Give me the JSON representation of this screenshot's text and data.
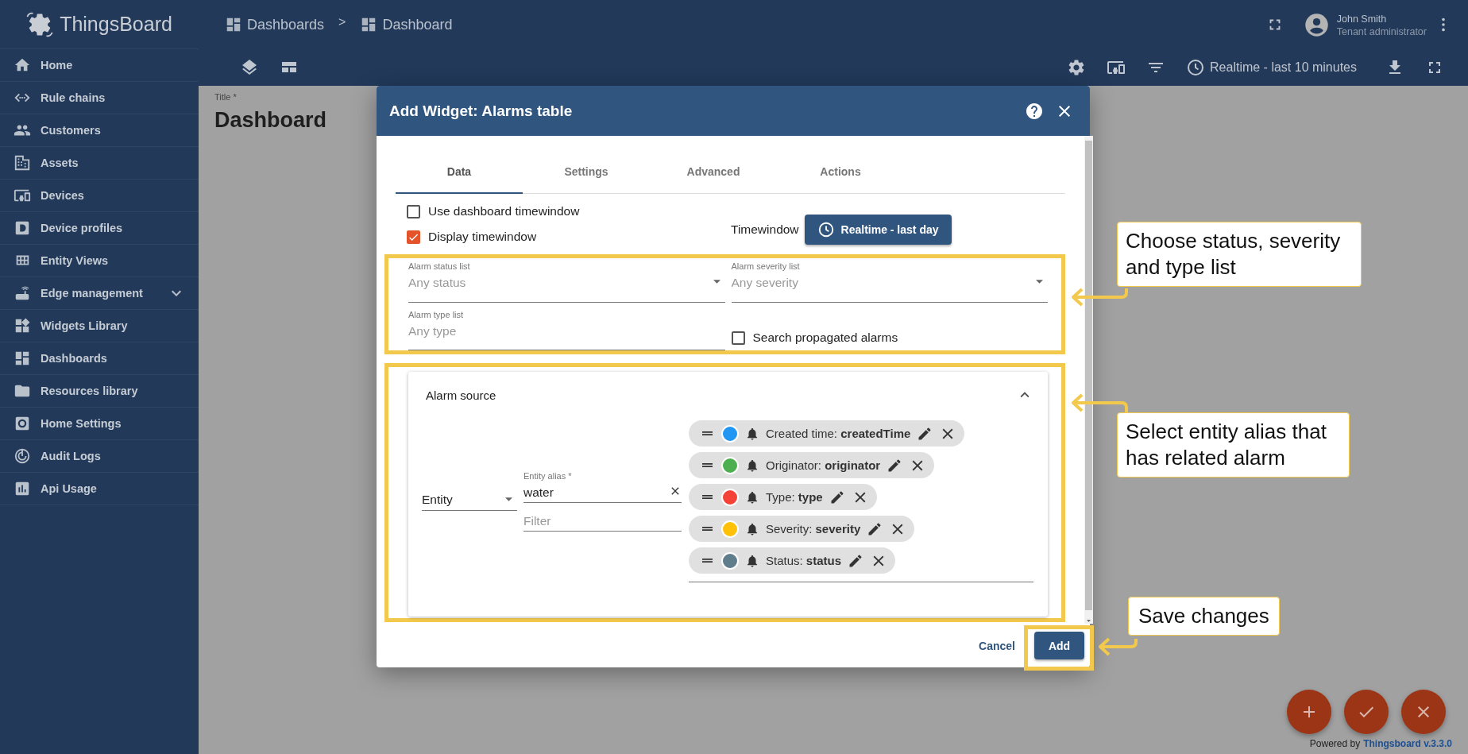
{
  "sidebar": {
    "logo": "ThingsBoard",
    "items": [
      {
        "label": "Home",
        "kind": "link"
      },
      {
        "label": "Rule chains",
        "kind": "link"
      },
      {
        "label": "Customers",
        "kind": "link"
      },
      {
        "label": "Assets",
        "kind": "link"
      },
      {
        "label": "Devices",
        "kind": "link"
      },
      {
        "label": "Device profiles",
        "kind": "link"
      },
      {
        "label": "Entity Views",
        "kind": "link"
      },
      {
        "label": "Edge management",
        "kind": "group"
      },
      {
        "label": "Widgets Library",
        "kind": "link"
      },
      {
        "label": "Dashboards",
        "kind": "link"
      },
      {
        "label": "Resources library",
        "kind": "link"
      },
      {
        "label": "Home Settings",
        "kind": "link"
      },
      {
        "label": "Audit Logs",
        "kind": "link"
      },
      {
        "label": "Api Usage",
        "kind": "link"
      }
    ]
  },
  "topbar": {
    "breadcrumbs": [
      {
        "label": "Dashboards"
      },
      {
        "label": "Dashboard"
      }
    ],
    "separator": ">",
    "user": {
      "name": "John Smith",
      "role": "Tenant administrator"
    }
  },
  "toolbar": {
    "timewindow": "Realtime - last 10 minutes"
  },
  "dashboard": {
    "title_label": "Title *",
    "title": "Dashboard"
  },
  "dialog": {
    "title": "Add Widget: Alarms table",
    "tabs": [
      {
        "label": "Data",
        "selected": true
      },
      {
        "label": "Settings",
        "selected": false
      },
      {
        "label": "Advanced",
        "selected": false
      },
      {
        "label": "Actions",
        "selected": false
      }
    ],
    "checkboxes": [
      {
        "label": "Use dashboard timewindow",
        "checked": false
      },
      {
        "label": "Display timewindow",
        "checked": true
      }
    ],
    "timewindow_label": "Timewindow",
    "timewindow_button": "Realtime - last day",
    "fields": [
      {
        "label": "Alarm status list",
        "placeholder": "Any status",
        "kind": "select"
      },
      {
        "label": "Alarm severity list",
        "placeholder": "Any severity",
        "kind": "select"
      },
      {
        "label": "Alarm type list",
        "placeholder": "Any type",
        "kind": "input"
      }
    ],
    "search_propagated": {
      "label": "Search propagated alarms",
      "checked": false
    },
    "alarm_source": {
      "title": "Alarm source",
      "expanded": true,
      "type_select": "Entity",
      "alias": {
        "label": "Entity alias *",
        "value": "water"
      },
      "filter": {
        "placeholder": "Filter"
      },
      "keys": [
        {
          "label": "Created time: **createdTime**",
          "color": "#2196f3"
        },
        {
          "label": "Originator: **originator**",
          "color": "#4caf50"
        },
        {
          "label": "Type: **type**",
          "color": "#f44336"
        },
        {
          "label": "Severity: **severity**",
          "color": "#ffc107"
        },
        {
          "label": "Status: **status**",
          "color": "#607d8b"
        }
      ]
    },
    "buttons": [
      {
        "label": "Cancel",
        "kind": "text"
      },
      {
        "label": "Add",
        "kind": "raised"
      }
    ]
  },
  "callouts": [
    {
      "text": "Choose status, severity and type list"
    },
    {
      "text": "Select entity alias that has related alarm"
    },
    {
      "text": "Save changes"
    }
  ],
  "footer": {
    "text": "Powered by",
    "link": "Thingsboard v.3.3.0"
  }
}
